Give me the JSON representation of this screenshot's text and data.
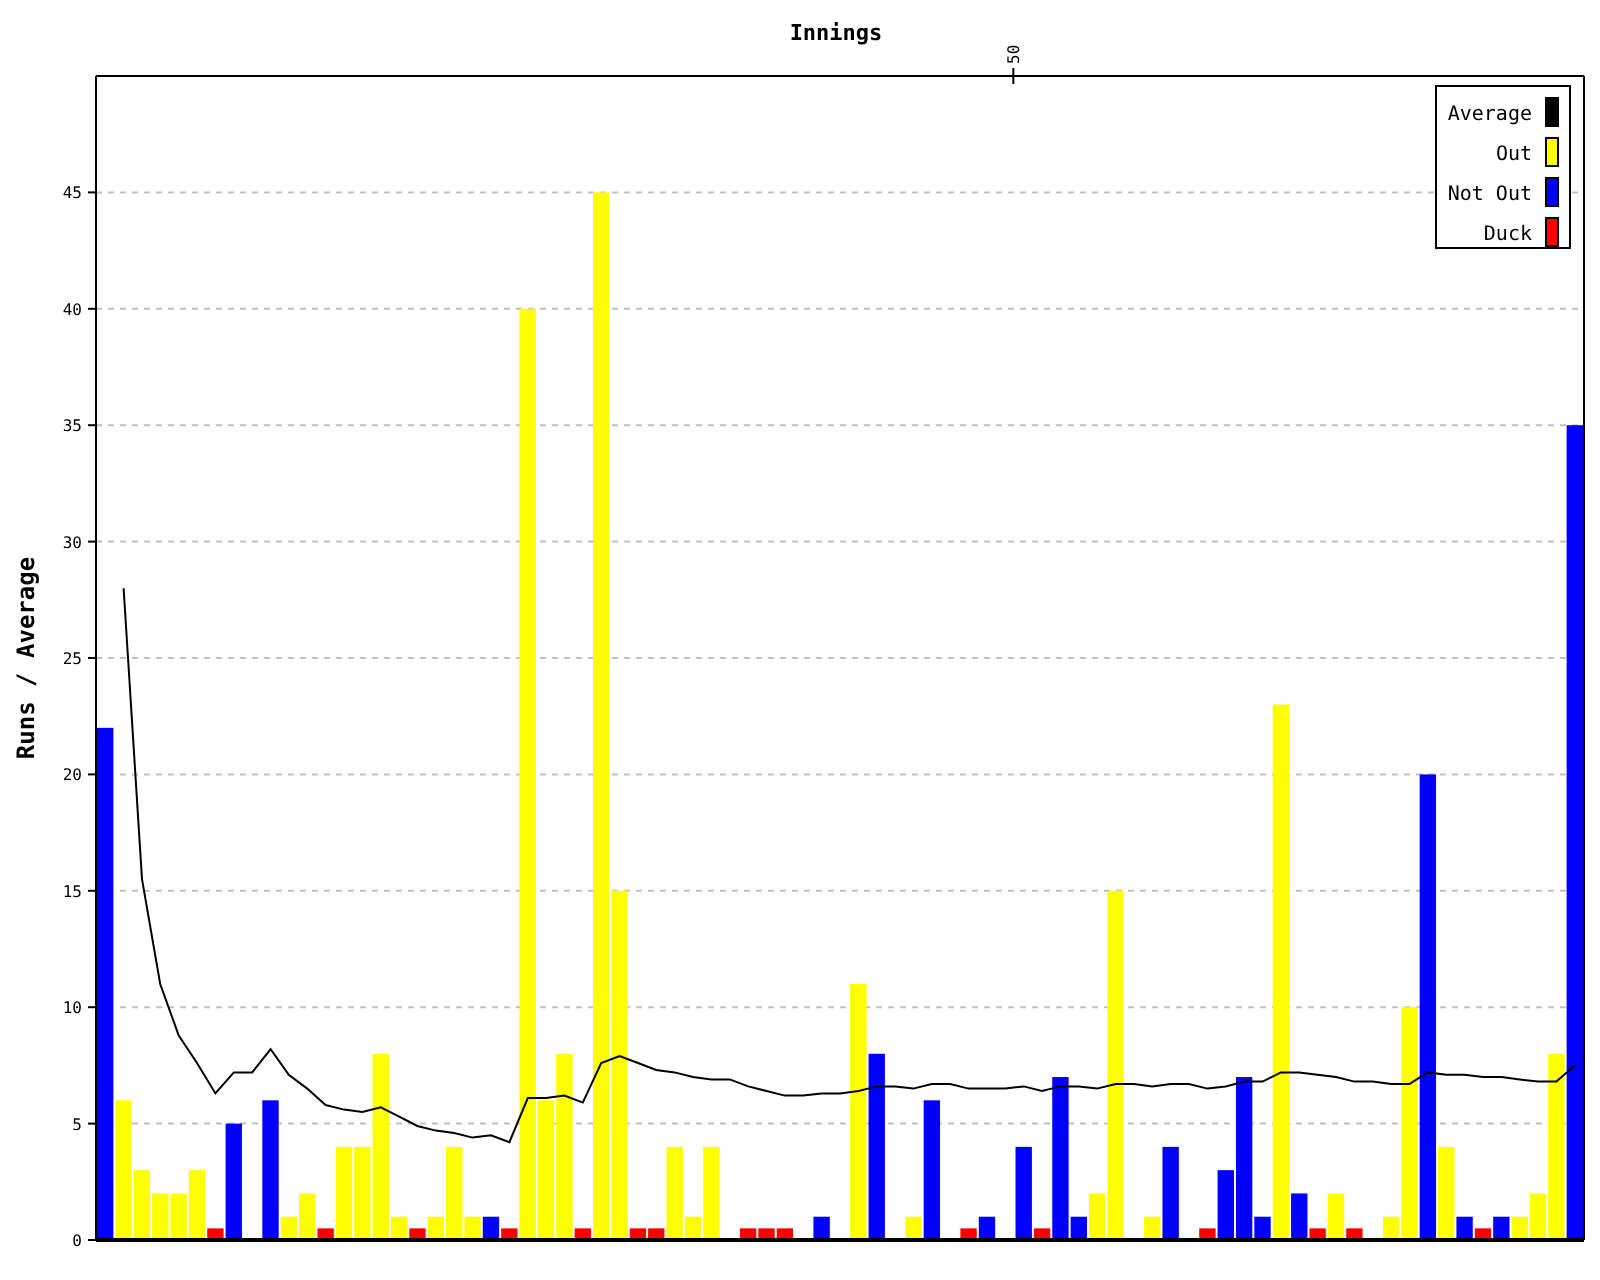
{
  "chart": {
    "chart_data": {
      "type": "bar",
      "title": "Innings",
      "ylabel": "Runs / Average",
      "ylim": [
        0,
        50
      ],
      "grid": true,
      "yticks": [
        {
          "value": 0,
          "label": "0"
        },
        {
          "value": 5,
          "label": "5"
        },
        {
          "value": 10,
          "label": "10"
        },
        {
          "value": 15,
          "label": "15"
        },
        {
          "value": 20,
          "label": "20"
        },
        {
          "value": 25,
          "label": "25"
        },
        {
          "value": 30,
          "label": "30"
        },
        {
          "value": 35,
          "label": "35"
        },
        {
          "value": 40,
          "label": "40"
        },
        {
          "value": 45,
          "label": "45"
        }
      ],
      "series": [
        {
          "name": "Out",
          "color": "#ffff00",
          "values": [
            null,
            6,
            3,
            2,
            2,
            3,
            null,
            null,
            null,
            null,
            1,
            2,
            null,
            4,
            4,
            8,
            1,
            null,
            1,
            4,
            1,
            null,
            null,
            40,
            6,
            8,
            null,
            45,
            15,
            null,
            null,
            4,
            1,
            4,
            null,
            null,
            null,
            null,
            null,
            null,
            null,
            11,
            null,
            null,
            1,
            null,
            null,
            null,
            null,
            null,
            null,
            null,
            null,
            null,
            2,
            15,
            null,
            1,
            null,
            null,
            null,
            null,
            null,
            null,
            23,
            null,
            null,
            2,
            null,
            null,
            1,
            10,
            null,
            4,
            null,
            null,
            null,
            1,
            2,
            8,
            null
          ]
        },
        {
          "name": "Not Out",
          "color": "#0000ff",
          "values": [
            22,
            null,
            null,
            null,
            null,
            null,
            null,
            5,
            null,
            6,
            null,
            null,
            null,
            null,
            null,
            null,
            null,
            null,
            null,
            null,
            null,
            1,
            null,
            null,
            null,
            null,
            null,
            null,
            null,
            null,
            null,
            null,
            null,
            null,
            null,
            null,
            null,
            null,
            null,
            1,
            null,
            null,
            8,
            null,
            null,
            6,
            null,
            null,
            1,
            null,
            4,
            null,
            7,
            1,
            null,
            null,
            null,
            null,
            4,
            null,
            null,
            3,
            7,
            1,
            null,
            2,
            null,
            null,
            null,
            null,
            null,
            null,
            20,
            null,
            1,
            null,
            1,
            null,
            null,
            null,
            35
          ]
        },
        {
          "name": "Duck",
          "color": "#ff0000",
          "values": [
            null,
            null,
            null,
            null,
            null,
            null,
            0.5,
            null,
            null,
            null,
            null,
            null,
            0.5,
            null,
            null,
            null,
            null,
            0.5,
            null,
            null,
            null,
            null,
            0.5,
            null,
            null,
            null,
            0.5,
            null,
            null,
            0.5,
            0.5,
            null,
            null,
            null,
            null,
            0.5,
            0.5,
            0.5,
            null,
            null,
            null,
            null,
            null,
            null,
            null,
            null,
            null,
            0.5,
            null,
            null,
            null,
            0.5,
            null,
            null,
            null,
            null,
            null,
            null,
            null,
            null,
            0.5,
            null,
            null,
            null,
            null,
            null,
            0.5,
            null,
            0.5,
            null,
            null,
            null,
            null,
            null,
            null,
            0.5,
            null,
            null,
            null,
            null,
            null
          ]
        }
      ]
    },
    "top_axis": {
      "tick_label": "50"
    }
  },
  "average_line": {
    "chart_data": {
      "type": "line",
      "ylim": [
        0,
        50
      ],
      "series": [
        {
          "name": "Average",
          "color": "#000000",
          "values": [
            null,
            28,
            15.5,
            11,
            8.8,
            7.6,
            6.3,
            7.2,
            7.2,
            8.2,
            7.1,
            6.5,
            5.8,
            5.6,
            5.5,
            5.7,
            5.3,
            4.9,
            4.7,
            4.6,
            4.4,
            4.5,
            4.2,
            6.1,
            6.1,
            6.2,
            5.9,
            7.6,
            7.9,
            7.6,
            7.3,
            7.2,
            7,
            6.9,
            6.9,
            6.6,
            6.4,
            6.2,
            6.2,
            6.3,
            6.3,
            6.4,
            6.6,
            6.6,
            6.5,
            6.7,
            6.7,
            6.5,
            6.5,
            6.5,
            6.6,
            6.4,
            6.6,
            6.6,
            6.5,
            6.7,
            6.7,
            6.6,
            6.7,
            6.7,
            6.5,
            6.6,
            6.8,
            6.8,
            7.2,
            7.2,
            7.1,
            7,
            6.8,
            6.8,
            6.7,
            6.7,
            7.2,
            7.1,
            7.1,
            7,
            7,
            6.9,
            6.8,
            6.8,
            7.5
          ]
        }
      ]
    }
  }
}
